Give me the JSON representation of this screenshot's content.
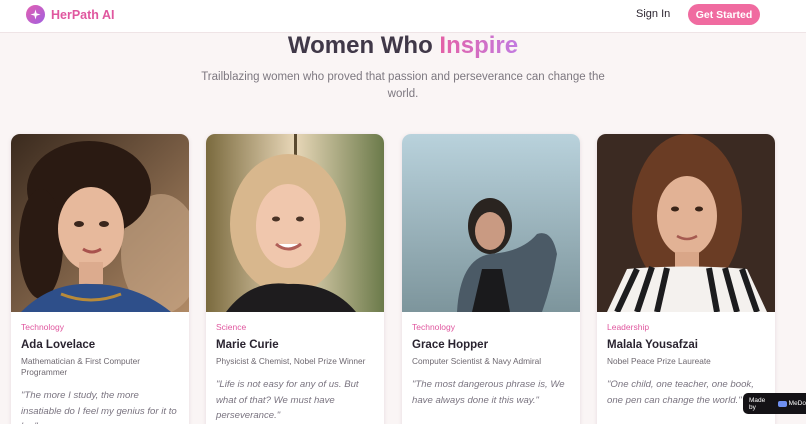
{
  "header": {
    "brand": "HerPath AI",
    "sign_in": "Sign In",
    "get_started": "Get Started"
  },
  "hero": {
    "title_main": "Women Who ",
    "title_accent": "Inspire",
    "subtitle": "Trailblazing women who proved that passion and perseverance can change the world."
  },
  "cards": [
    {
      "category": "Technology",
      "name": "Ada Lovelace",
      "role": "Mathematician & First Computer Programmer",
      "quote": "\"The more I study, the more insatiable do I feel my genius for it to be.\""
    },
    {
      "category": "Science",
      "name": "Marie Curie",
      "role": "Physicist & Chemist, Nobel Prize Winner",
      "quote": "\"Life is not easy for any of us. But what of that? We must have perseverance.\""
    },
    {
      "category": "Technology",
      "name": "Grace Hopper",
      "role": "Computer Scientist & Navy Admiral",
      "quote": "\"The most dangerous phrase is, We have always done it this way.\""
    },
    {
      "category": "Leadership",
      "name": "Malala Yousafzai",
      "role": "Nobel Peace Prize Laureate",
      "quote": "\"One child, one teacher, one book, one pen can change the world.\""
    }
  ],
  "badge": {
    "label": "Made by",
    "brand": "MeDo"
  },
  "colors": {
    "accent": "#f06ba0",
    "brand_text": "#e0579f",
    "background": "#faf5f5"
  },
  "icons": {
    "logo": "sparkle-icon"
  }
}
